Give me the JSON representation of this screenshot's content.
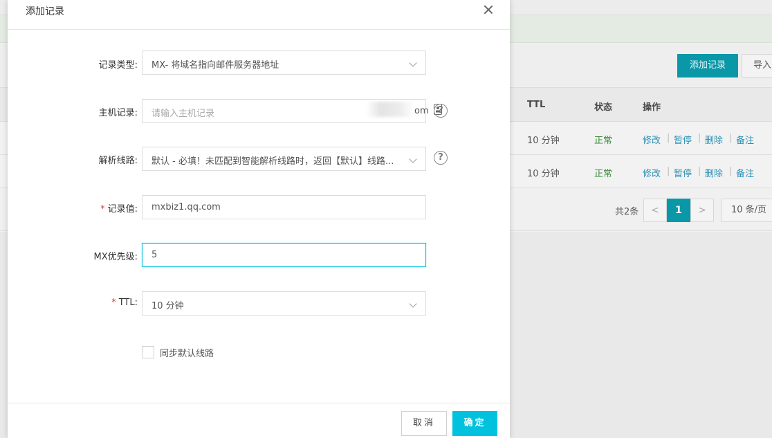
{
  "background": {
    "add_record_button": "添加记录",
    "import_button": "导入",
    "table": {
      "headers": [
        "TTL",
        "状态",
        "操作"
      ],
      "rows": [
        {
          "ttl": "10 分钟",
          "status": "正常",
          "actions": [
            "修改",
            "暂停",
            "删除",
            "备注"
          ]
        },
        {
          "ttl": "10 分钟",
          "status": "正常",
          "actions": [
            "修改",
            "暂停",
            "删除",
            "备注"
          ]
        }
      ]
    },
    "pagination": {
      "total": "共2条",
      "prev": "<",
      "current_page": "1",
      "next": ">",
      "page_size": "10 条/页"
    }
  },
  "modal": {
    "title": "添加记录",
    "fields": {
      "record_type": {
        "label": "记录类型:",
        "value": "MX- 将域名指向邮件服务器地址"
      },
      "host": {
        "label": "主机记录:",
        "placeholder": "请输入主机记录",
        "suffix": "om"
      },
      "line": {
        "label": "解析线路:",
        "value": "默认 - 必填！未匹配到智能解析线路时，返回【默认】线路..."
      },
      "record_value": {
        "label": "记录值:",
        "required_mark": "*",
        "value": "mxbiz1.qq.com"
      },
      "mx_priority": {
        "label": "MX优先级:",
        "value": "5"
      },
      "ttl": {
        "label": "TTL:",
        "required_mark": "*",
        "value": "10 分钟"
      }
    },
    "sync_default_line": {
      "label": "同步默认线路",
      "checked": false
    },
    "help_glyph": "?",
    "buttons": {
      "cancel": "取消",
      "confirm": "确定"
    }
  },
  "colors": {
    "accent": "#00c1de",
    "bg_primary": "#0a97a8",
    "required": "#e4393c",
    "status_normal": "#3a8a3a",
    "link": "#2a90b5"
  },
  "icons": {
    "close": "close-icon",
    "chevron": "chevron-down-icon",
    "host_suffix": "id-card-icon",
    "help": "help-circle-icon"
  }
}
